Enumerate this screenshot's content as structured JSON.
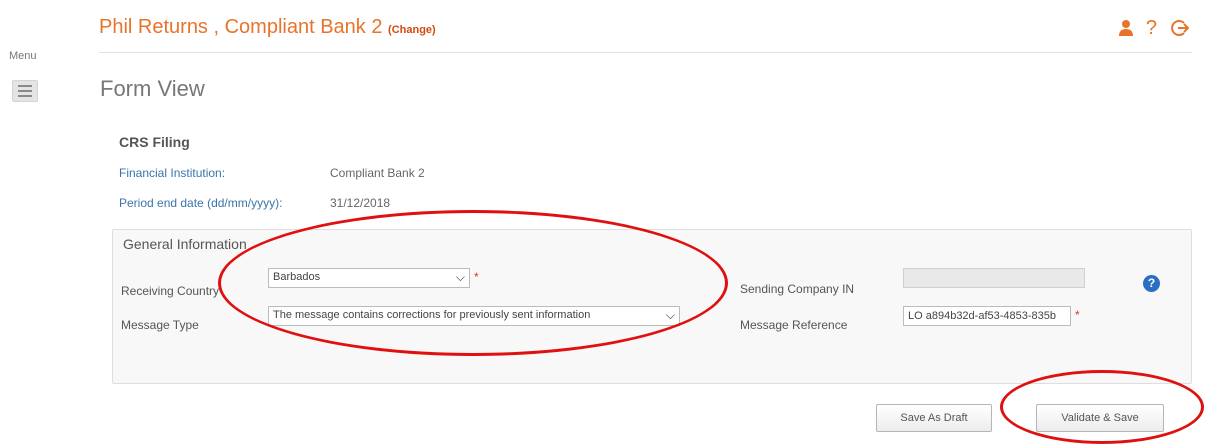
{
  "menu": {
    "label": "Menu"
  },
  "header": {
    "title": "Phil Returns , Compliant Bank 2",
    "change_label": "(Change)",
    "icons": [
      "user-icon",
      "help-icon",
      "logout-icon"
    ],
    "accent_color": "#e8732a"
  },
  "page": {
    "title": "Form View"
  },
  "crs": {
    "title": "CRS Filing",
    "financial_institution_label": "Financial Institution:",
    "financial_institution_value": "Compliant Bank 2",
    "period_end_label": "Period end date (dd/mm/yyyy):",
    "period_end_value": "31/12/2018"
  },
  "general": {
    "title": "General Information",
    "receiving_country_label": "Receiving Country",
    "receiving_country_value": "Barbados",
    "message_type_label": "Message Type",
    "message_type_value": "The message contains corrections for previously sent information",
    "sending_company_label": "Sending Company IN",
    "sending_company_value": "",
    "message_reference_label": "Message Reference",
    "message_reference_value": "LO a894b32d-af53-4853-835b",
    "required_marker": "*"
  },
  "buttons": {
    "save_draft": "Save As Draft",
    "validate_save": "Validate & Save"
  },
  "annotation_color": "#e01010"
}
